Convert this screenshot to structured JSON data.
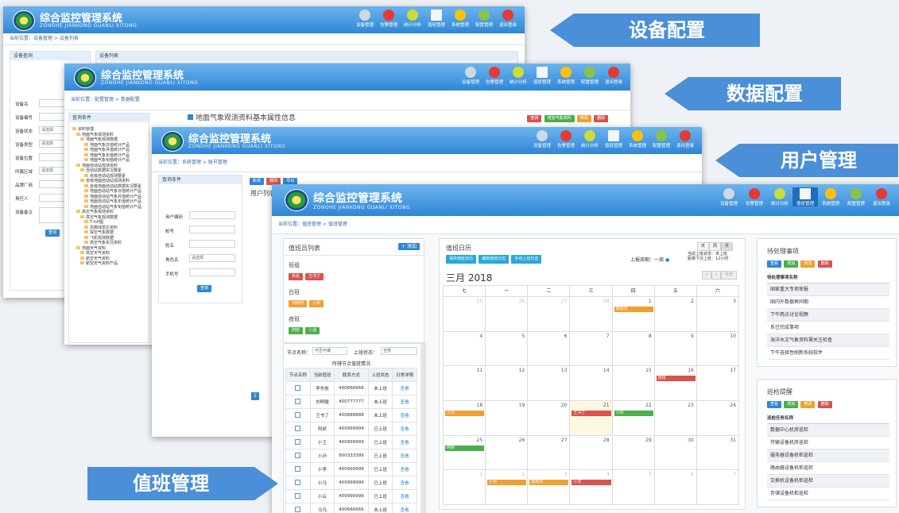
{
  "app": {
    "title": "综合监控管理系统",
    "subtitle": "ZONGHE JIANKONG GUANLI XITONG",
    "toolbar": [
      "设备管理",
      "告警管理",
      "统计分析",
      "值班管理",
      "系统管理",
      "配置管理",
      "退出登录"
    ]
  },
  "banners": [
    "设备配置",
    "数据配置",
    "用户管理",
    "值班管理"
  ],
  "win1": {
    "breadcrumb": "当前位置：设备管理 > 设备列表",
    "left_title": "设备查询",
    "right_title": "设备列表",
    "fields": [
      "设备名",
      "设备编号",
      "设备状态",
      "设备类型",
      "设备位置",
      "所属区域",
      "品牌厂商",
      "责任人",
      "设备备注"
    ],
    "select_placeholder": "请选择",
    "query_button": "查询"
  },
  "win2": {
    "breadcrumb": "当前位置：配置管理 > 数据配置",
    "left_title": "查询条件",
    "content_title": "地面气象观测资料基本属性信息",
    "buttons": [
      "查询",
      "增加气象资料",
      "修改",
      "删除"
    ],
    "tree": [
      "资料管理",
      "地面气象观测资料",
      "地面气象观测数据",
      "地面气象日值统计产品",
      "地面气象月值统计产品",
      "地面气象年值统计产品",
      "地面气象旬值统计产品",
      "地面自动站观测资料",
      "自动站数据实况要素",
      "省级自动站观测要素",
      "省级地面自动站观测资料",
      "省级地面自动站数据实况要素",
      "地面自动站气象日值统计产品",
      "地面自动站气象月值统计产品",
      "地面自动站气象年值统计产品",
      "地面自动站气象旬值统计产品",
      "高空气象观测资料",
      "高空气象观测数据",
      "T-lnP图",
      "风廓线雷达资料",
      "探空气象数据",
      "飞机观测数据",
      "高空气象实况资料",
      "地面天气资料",
      "高空天气资料",
      "航空天气资料",
      "航空天气资料产品"
    ]
  },
  "win3": {
    "breadcrumb": "当前位置：系统管理 > 账号管理",
    "left_title": "查询条件",
    "table_title": "用户列表",
    "fields": [
      "用户编码",
      "帐号",
      "姓名",
      "角色名",
      "手机号"
    ],
    "select_placeholder": "请选择",
    "query_button": "查询",
    "buttons": [
      "新增",
      "删除",
      "导出"
    ],
    "page": "1"
  },
  "win4": {
    "breadcrumb": "当前位置：值班管理 > 值班管理",
    "roster": {
      "title": "值班员列表",
      "add_button": "添加",
      "groups": [
        {
          "name": "班组",
          "members": [
            "佚名",
            "王书丁"
          ],
          "colors": [
            "#d9534f",
            "#d9534f"
          ]
        },
        {
          "name": "白班",
          "members": [
            "刘晓明",
            "小张"
          ],
          "colors": [
            "#f0a030",
            "#f0a030"
          ]
        },
        {
          "name": "夜班",
          "members": [
            "阿娇",
            "小迪"
          ],
          "colors": [
            "#4cae4c",
            "#4cae4c"
          ]
        }
      ]
    },
    "node": {
      "label": "节点名称：",
      "select": "可否可编",
      "status_label": "上班状态：",
      "status_select": "全部",
      "table_title": "所辖节点值班情况",
      "columns": [
        "节点名称",
        "当前值班",
        "联系方式",
        "上班状态",
        "日常详情"
      ],
      "rows": [
        [
          "李东航",
          "400666666",
          "未上班",
          "查看"
        ],
        [
          "刘明耀",
          "400777777",
          "未上班",
          "查看"
        ],
        [
          "王书丁",
          "400888888",
          "未上班",
          "查看"
        ],
        [
          "阿娇",
          "400999999",
          "已上班",
          "查看"
        ],
        [
          "小王",
          "400999999",
          "已上班",
          "查看"
        ],
        [
          "小孙",
          "800333399",
          "已上班",
          "查看"
        ],
        [
          "小李",
          "400999999",
          "已上班",
          "查看"
        ],
        [
          "小马",
          "400999999",
          "已上班",
          "查看"
        ],
        [
          "小云",
          "400999999",
          "已上班",
          "查看"
        ],
        [
          "马乌",
          "400666666",
          "未上班",
          "查看"
        ]
      ]
    },
    "calendar": {
      "title": "值班日历",
      "buttons": [
        "保存值班日历",
        "编辑值班日志",
        "手动上班日志"
      ],
      "week_label": "上报周期：一周",
      "view_tabs": [
        "天",
        "周",
        "月"
      ],
      "shift_info_1": "当前上班状态：未上班",
      "shift_info_2": "距离下次上班：12小时",
      "month": "三月 2018",
      "today": "今天",
      "weekdays": [
        "七",
        "一",
        "二",
        "三",
        "四",
        "五",
        "六"
      ],
      "days": [
        "25",
        "26",
        "27",
        "28",
        "1",
        "2",
        "3",
        "4",
        "5",
        "6",
        "7",
        "8",
        "9",
        "10",
        "11",
        "12",
        "13",
        "14",
        "15",
        "16",
        "17",
        "18",
        "19",
        "20",
        "21",
        "22",
        "23",
        "24",
        "25",
        "26",
        "27",
        "28",
        "29",
        "30",
        "31",
        "1",
        "2",
        "3",
        "4",
        "5",
        "6",
        "7"
      ],
      "events": [
        {
          "day_index": 4,
          "label": "值班员",
          "color": "#f0a030"
        },
        {
          "day_index": 19,
          "label": "值班",
          "color": "#d9534f"
        },
        {
          "day_index": 21,
          "label": "小刘",
          "color": "#f0a030"
        },
        {
          "day_index": 24,
          "label": "王书丁",
          "color": "#d9534f"
        },
        {
          "day_index": 25,
          "label": "小孙",
          "color": "#4cae4c"
        },
        {
          "day_index": 28,
          "label": "阿娇",
          "color": "#4cae4c"
        },
        {
          "day_index": 36,
          "label": "小孙",
          "color": "#f0a030"
        },
        {
          "day_index": 37,
          "label": "值班员",
          "color": "#f0a030"
        },
        {
          "day_index": 38,
          "label": "小刘",
          "color": "#d9534f"
        }
      ]
    },
    "todo": {
      "title": "待处理事项",
      "buttons": [
        "查看",
        "增加",
        "修改",
        "删除"
      ],
      "header": "待处理事项名称",
      "items": [
        "国家重大专项审报",
        "国内外数据再同期",
        "下午两点讨论视察",
        "系已完成事项",
        "海洋水文气象资料需关注检查",
        "下午选择性刷新系统软件"
      ]
    },
    "patrol": {
      "title": "巡检提醒",
      "buttons": [
        "查看",
        "增加",
        "修改",
        "删除"
      ],
      "header": "巡检任务名称",
      "items": [
        "数据中心机房巡检",
        "传输设备机房巡检",
        "服务器设备机柜巡检",
        "路由器设备机柜巡检",
        "交换机设备机柜巡检",
        "存储设备机柜巡检"
      ]
    }
  }
}
